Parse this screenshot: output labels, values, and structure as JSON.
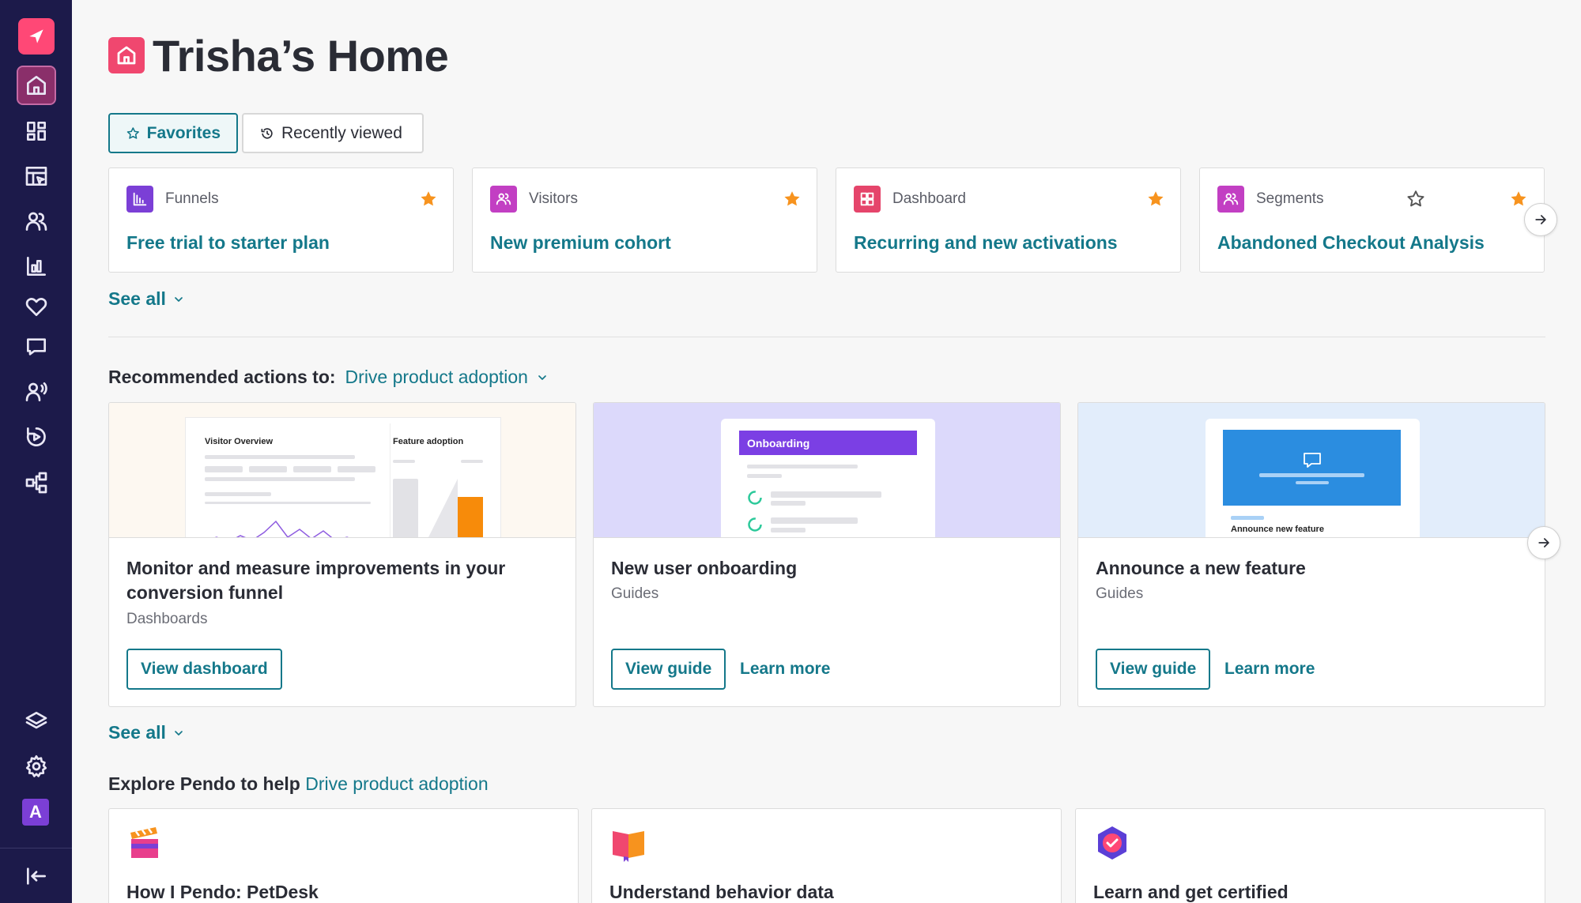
{
  "sidebar": {
    "logo": "pendo-logo-icon",
    "items": [
      {
        "icon": "home-icon",
        "active": true
      },
      {
        "icon": "dashboard-grid-icon"
      },
      {
        "icon": "product-pointer-icon"
      },
      {
        "icon": "people-icon"
      },
      {
        "icon": "bar-chart-icon"
      },
      {
        "icon": "heart-icon"
      },
      {
        "icon": "message-icon"
      },
      {
        "icon": "feedback-voice-icon"
      },
      {
        "icon": "replay-icon"
      },
      {
        "icon": "workflow-icon"
      }
    ],
    "bottom": [
      {
        "icon": "layers-icon"
      },
      {
        "icon": "gear-icon"
      }
    ],
    "avatar_letter": "A",
    "collapse_icon": "collapse-sidebar-icon"
  },
  "page": {
    "title": "Trisha’s Home",
    "title_icon": "home-icon"
  },
  "tabs": [
    {
      "label": "Favorites",
      "icon": "star-icon",
      "active": true
    },
    {
      "label": "Recently viewed",
      "icon": "history-icon",
      "active": false
    }
  ],
  "favorites": [
    {
      "type": "Funnels",
      "title": "Free trial to starter plan",
      "icon": "funnel-icon",
      "color": "#7b3fd6",
      "starred": true
    },
    {
      "type": "Visitors",
      "title": "New premium cohort",
      "icon": "visitors-icon",
      "color": "#c23fc3",
      "starred": true
    },
    {
      "type": "Dashboard",
      "title": "Recurring and new activations",
      "icon": "dashboard-icon",
      "color": "#e5456b",
      "starred": true
    },
    {
      "type": "Segments",
      "title": "Abandoned Checkout Analysis",
      "icon": "segments-icon",
      "color": "#c23fc3",
      "starred": false
    }
  ],
  "see_all_label": "See all",
  "recommended": {
    "prefix": "Recommended actions to:",
    "goal": "Drive product adoption",
    "cards": [
      {
        "title": "Monitor and measure improvements in your conversion funnel",
        "category": "Dashboards",
        "primary_label": "View dashboard",
        "preview": {
          "left_label": "Visitor Overview",
          "right_label": "Feature adoption"
        }
      },
      {
        "title": "New user onboarding",
        "category": "Guides",
        "primary_label": "View guide",
        "secondary_label": "Learn more",
        "preview": {
          "header_label": "Onboarding"
        }
      },
      {
        "title": "Announce a new feature",
        "category": "Guides",
        "primary_label": "View guide",
        "secondary_label": "Learn more",
        "preview": {
          "caption": "Announce new feature"
        }
      }
    ]
  },
  "explore": {
    "prefix": "Explore Pendo to help",
    "goal": "Drive product adoption",
    "cards": [
      {
        "title": "How I Pendo: PetDesk",
        "icon": "clapperboard-icon"
      },
      {
        "title": "Understand behavior data",
        "icon": "book-icon"
      },
      {
        "title": "Learn and get certified",
        "icon": "certified-badge-icon"
      }
    ]
  },
  "colors": {
    "sidebar": "#1c1a4a",
    "accent": "#14788a",
    "star": "#f7931e",
    "brand_pink": "#ff4876"
  }
}
